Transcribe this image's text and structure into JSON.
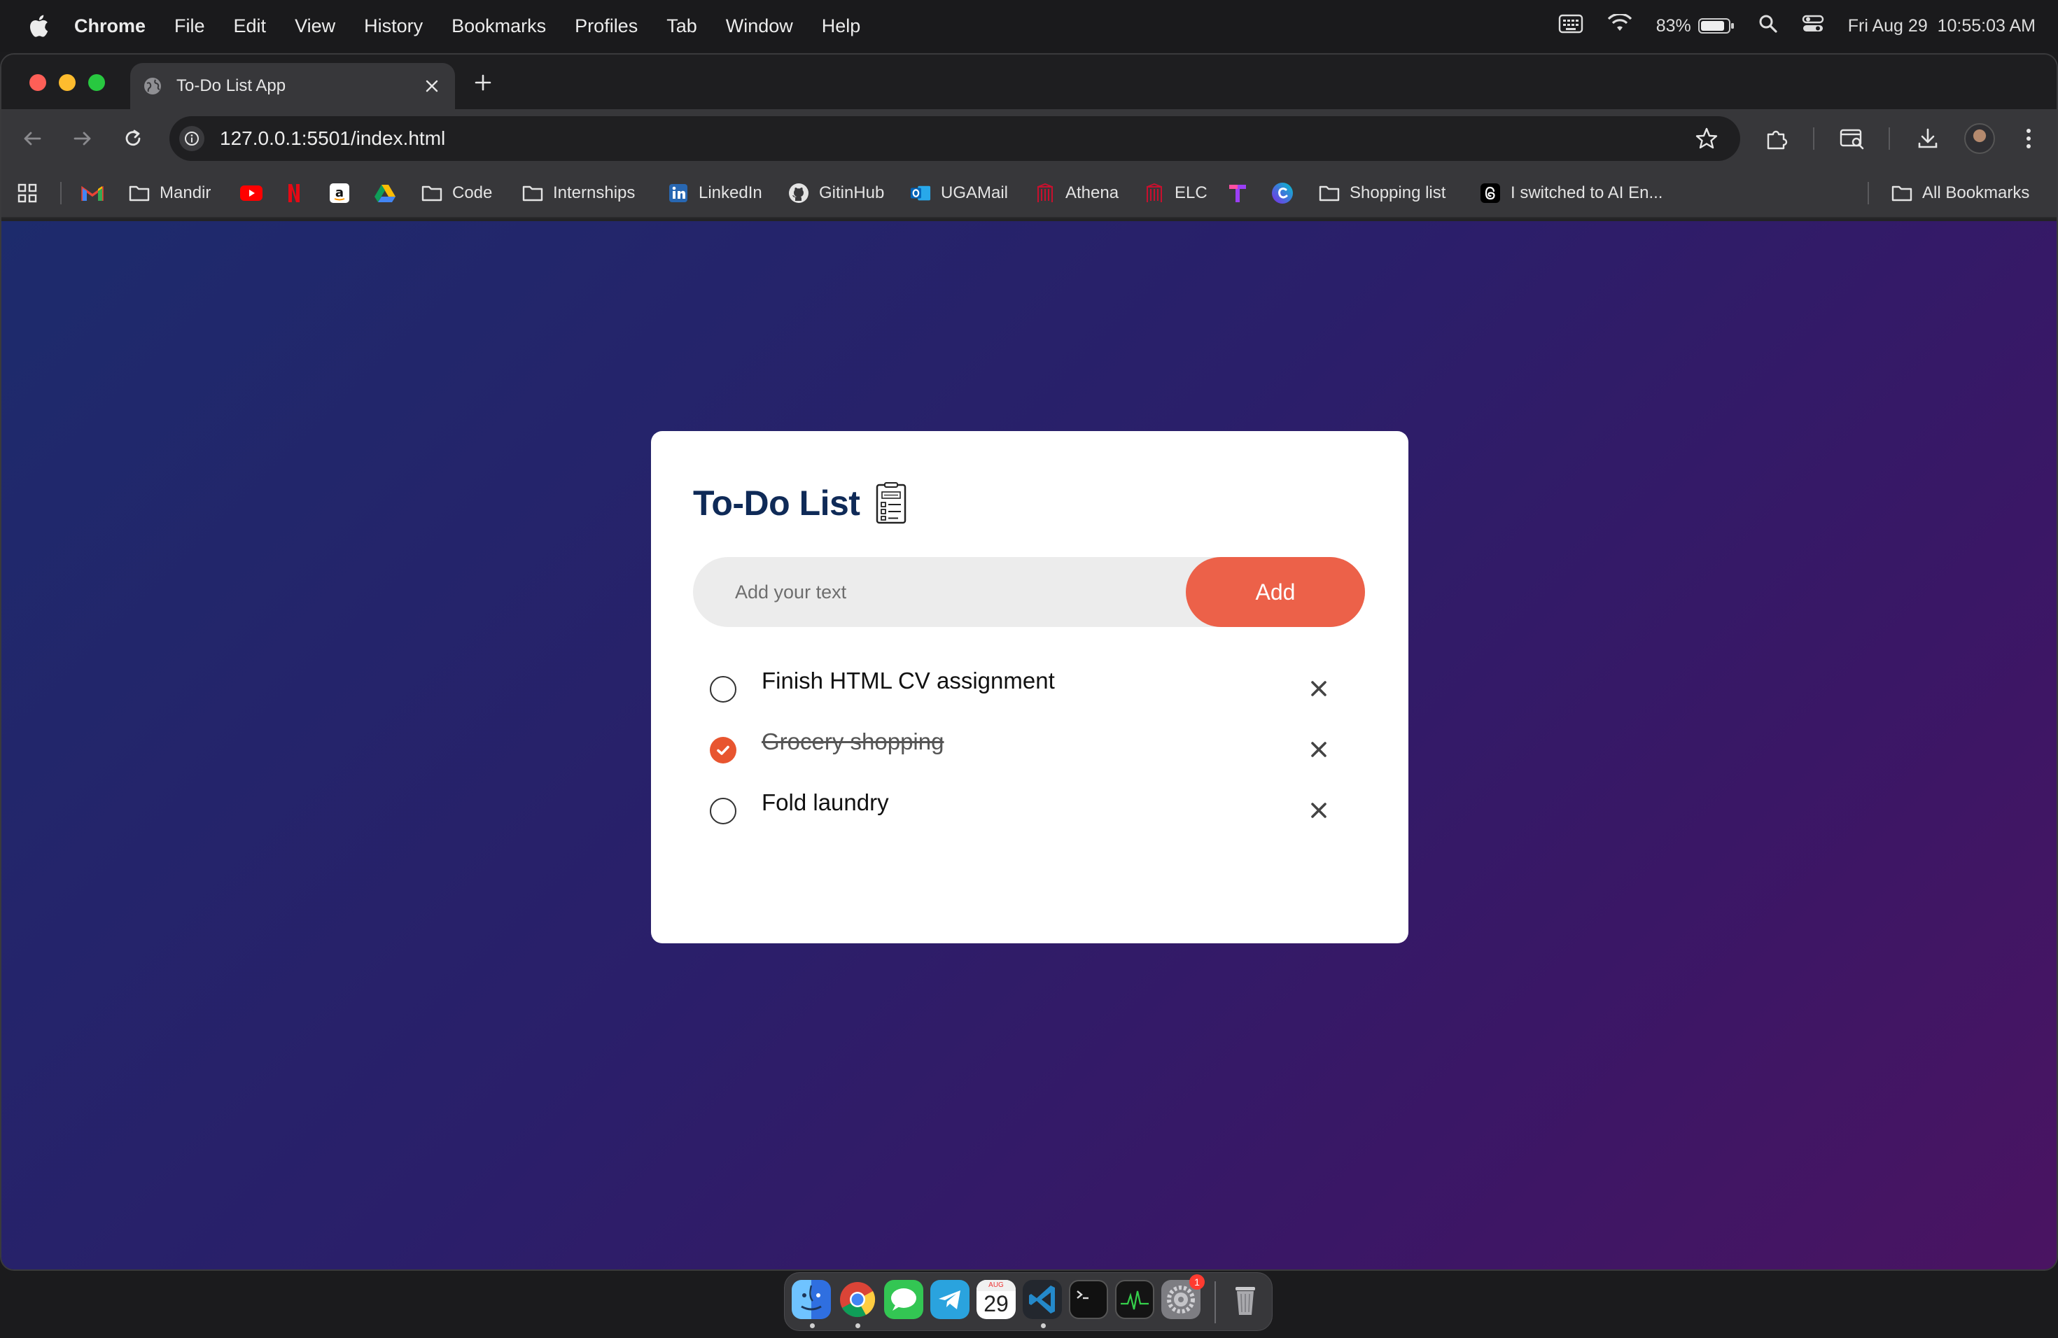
{
  "menubar": {
    "app_name": "Chrome",
    "items": [
      "File",
      "Edit",
      "View",
      "History",
      "Bookmarks",
      "Profiles",
      "Tab",
      "Window",
      "Help"
    ],
    "battery": "83%",
    "clock": "Fri Aug 29  10:55:03 AM"
  },
  "browser": {
    "tab_title": "To-Do List App",
    "url": "127.0.0.1:5501/index.html",
    "bookmarks": [
      "Mandir",
      "Code",
      "Internships",
      "LinkedIn",
      "GitinHub",
      "UGAMail",
      "Athena",
      "ELC",
      "Shopping list",
      "I switched to AI En...",
      "All Bookmarks"
    ]
  },
  "app": {
    "title": "To-Do List",
    "input_placeholder": "Add your text",
    "add_label": "Add",
    "tasks": [
      {
        "text": "Finish HTML CV assignment",
        "done": false
      },
      {
        "text": "Grocery shopping",
        "done": true
      },
      {
        "text": "Fold laundry",
        "done": false
      }
    ]
  },
  "dock": {
    "calendar_month": "AUG",
    "calendar_day": "29",
    "settings_badge": "1"
  },
  "colors": {
    "accent": "#ec6149",
    "check": "#e8552f",
    "title": "#0f2a57",
    "bg_start": "#1d2b6c",
    "bg_end": "#4a1462"
  }
}
